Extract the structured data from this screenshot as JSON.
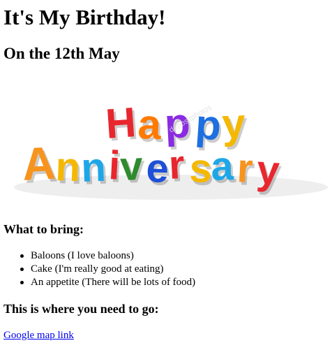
{
  "header": {
    "title": "It's My Birthday!",
    "subtitle": "On the 12th May"
  },
  "banner": {
    "word1": "Happy",
    "word2": "Anniversary",
    "watermark": "depositphotos",
    "letter_colors_word1": [
      "#e8262e",
      "#ff7a00",
      "#8a2be2",
      "#1e6fe0",
      "#f5b800"
    ],
    "letter_colors_word2": [
      "#f7941d",
      "#f5b800",
      "#1ea7e8",
      "#e8262e",
      "#2e8b2e",
      "#1e4fd8",
      "#e8262e",
      "#f5b800",
      "#1ea7e8",
      "#f7941d",
      "#e8262e"
    ]
  },
  "bring": {
    "heading": "What to bring:",
    "items": [
      "Baloons (I love baloons)",
      "Cake (I'm really good at eating)",
      "An appetite (There will be lots of food)"
    ]
  },
  "directions": {
    "heading": "This is where you need to go:",
    "link_label": "Google map link"
  }
}
